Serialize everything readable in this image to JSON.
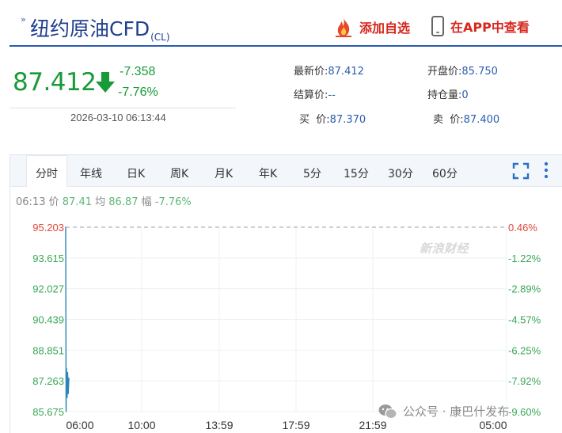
{
  "header": {
    "title": "纽约原油CFD",
    "code": "(CL)",
    "add_favorite_label": "添加自选",
    "view_in_app_label": "在APP中查看"
  },
  "price": {
    "last": "87.412",
    "change": "-7.358",
    "change_pct": "-7.76%",
    "datetime": "2026-03-10 06:13:44",
    "direction": "down"
  },
  "quote": {
    "latest_label": "最新价:",
    "latest": "87.412",
    "open_label": "开盘价:",
    "open": "85.750",
    "settle_label": "结算价:",
    "settle": "--",
    "position_label": "持仓量:",
    "position": "0",
    "bid_label": "买  价:",
    "bid": "87.370",
    "ask_label": "卖  价:",
    "ask": "87.400"
  },
  "tabs": [
    {
      "label": "分时",
      "active": true
    },
    {
      "label": "年线"
    },
    {
      "label": "日K"
    },
    {
      "label": "周K"
    },
    {
      "label": "月K"
    },
    {
      "label": "年K"
    },
    {
      "label": "5分"
    },
    {
      "label": "15分"
    },
    {
      "label": "30分"
    },
    {
      "label": "60分"
    }
  ],
  "info_bar": {
    "time": "06:13",
    "price_label": "价",
    "price": "87.41",
    "avg_label": "均",
    "avg": "86.87",
    "range_label": "幅",
    "range": "-7.76%"
  },
  "chart_data": {
    "type": "line",
    "y_ticks": [
      "95.203",
      "93.615",
      "92.027",
      "90.439",
      "88.851",
      "87.263",
      "85.675"
    ],
    "y_ticks_pct": [
      "0.46%",
      "-1.22%",
      "-2.89%",
      "-4.57%",
      "-6.25%",
      "-7.92%",
      "-9.60%"
    ],
    "x_ticks": [
      "06:00",
      "10:00",
      "13:59",
      "17:59",
      "21:59",
      "05:00"
    ],
    "ylim": [
      85.675,
      95.203
    ],
    "prev_close": 94.77,
    "series": [
      {
        "values": [
          95.203,
          85.675,
          87.9,
          86.4,
          87.7,
          86.6,
          87.41
        ]
      }
    ],
    "grid": true
  },
  "watermark": "新浪财经",
  "overlay": {
    "wechat_label": "公众号 · 康巴什发布"
  },
  "colors": {
    "down": "#179a37",
    "up": "#e0473b",
    "link": "#2a5db0",
    "header_red": "#d6271d"
  }
}
